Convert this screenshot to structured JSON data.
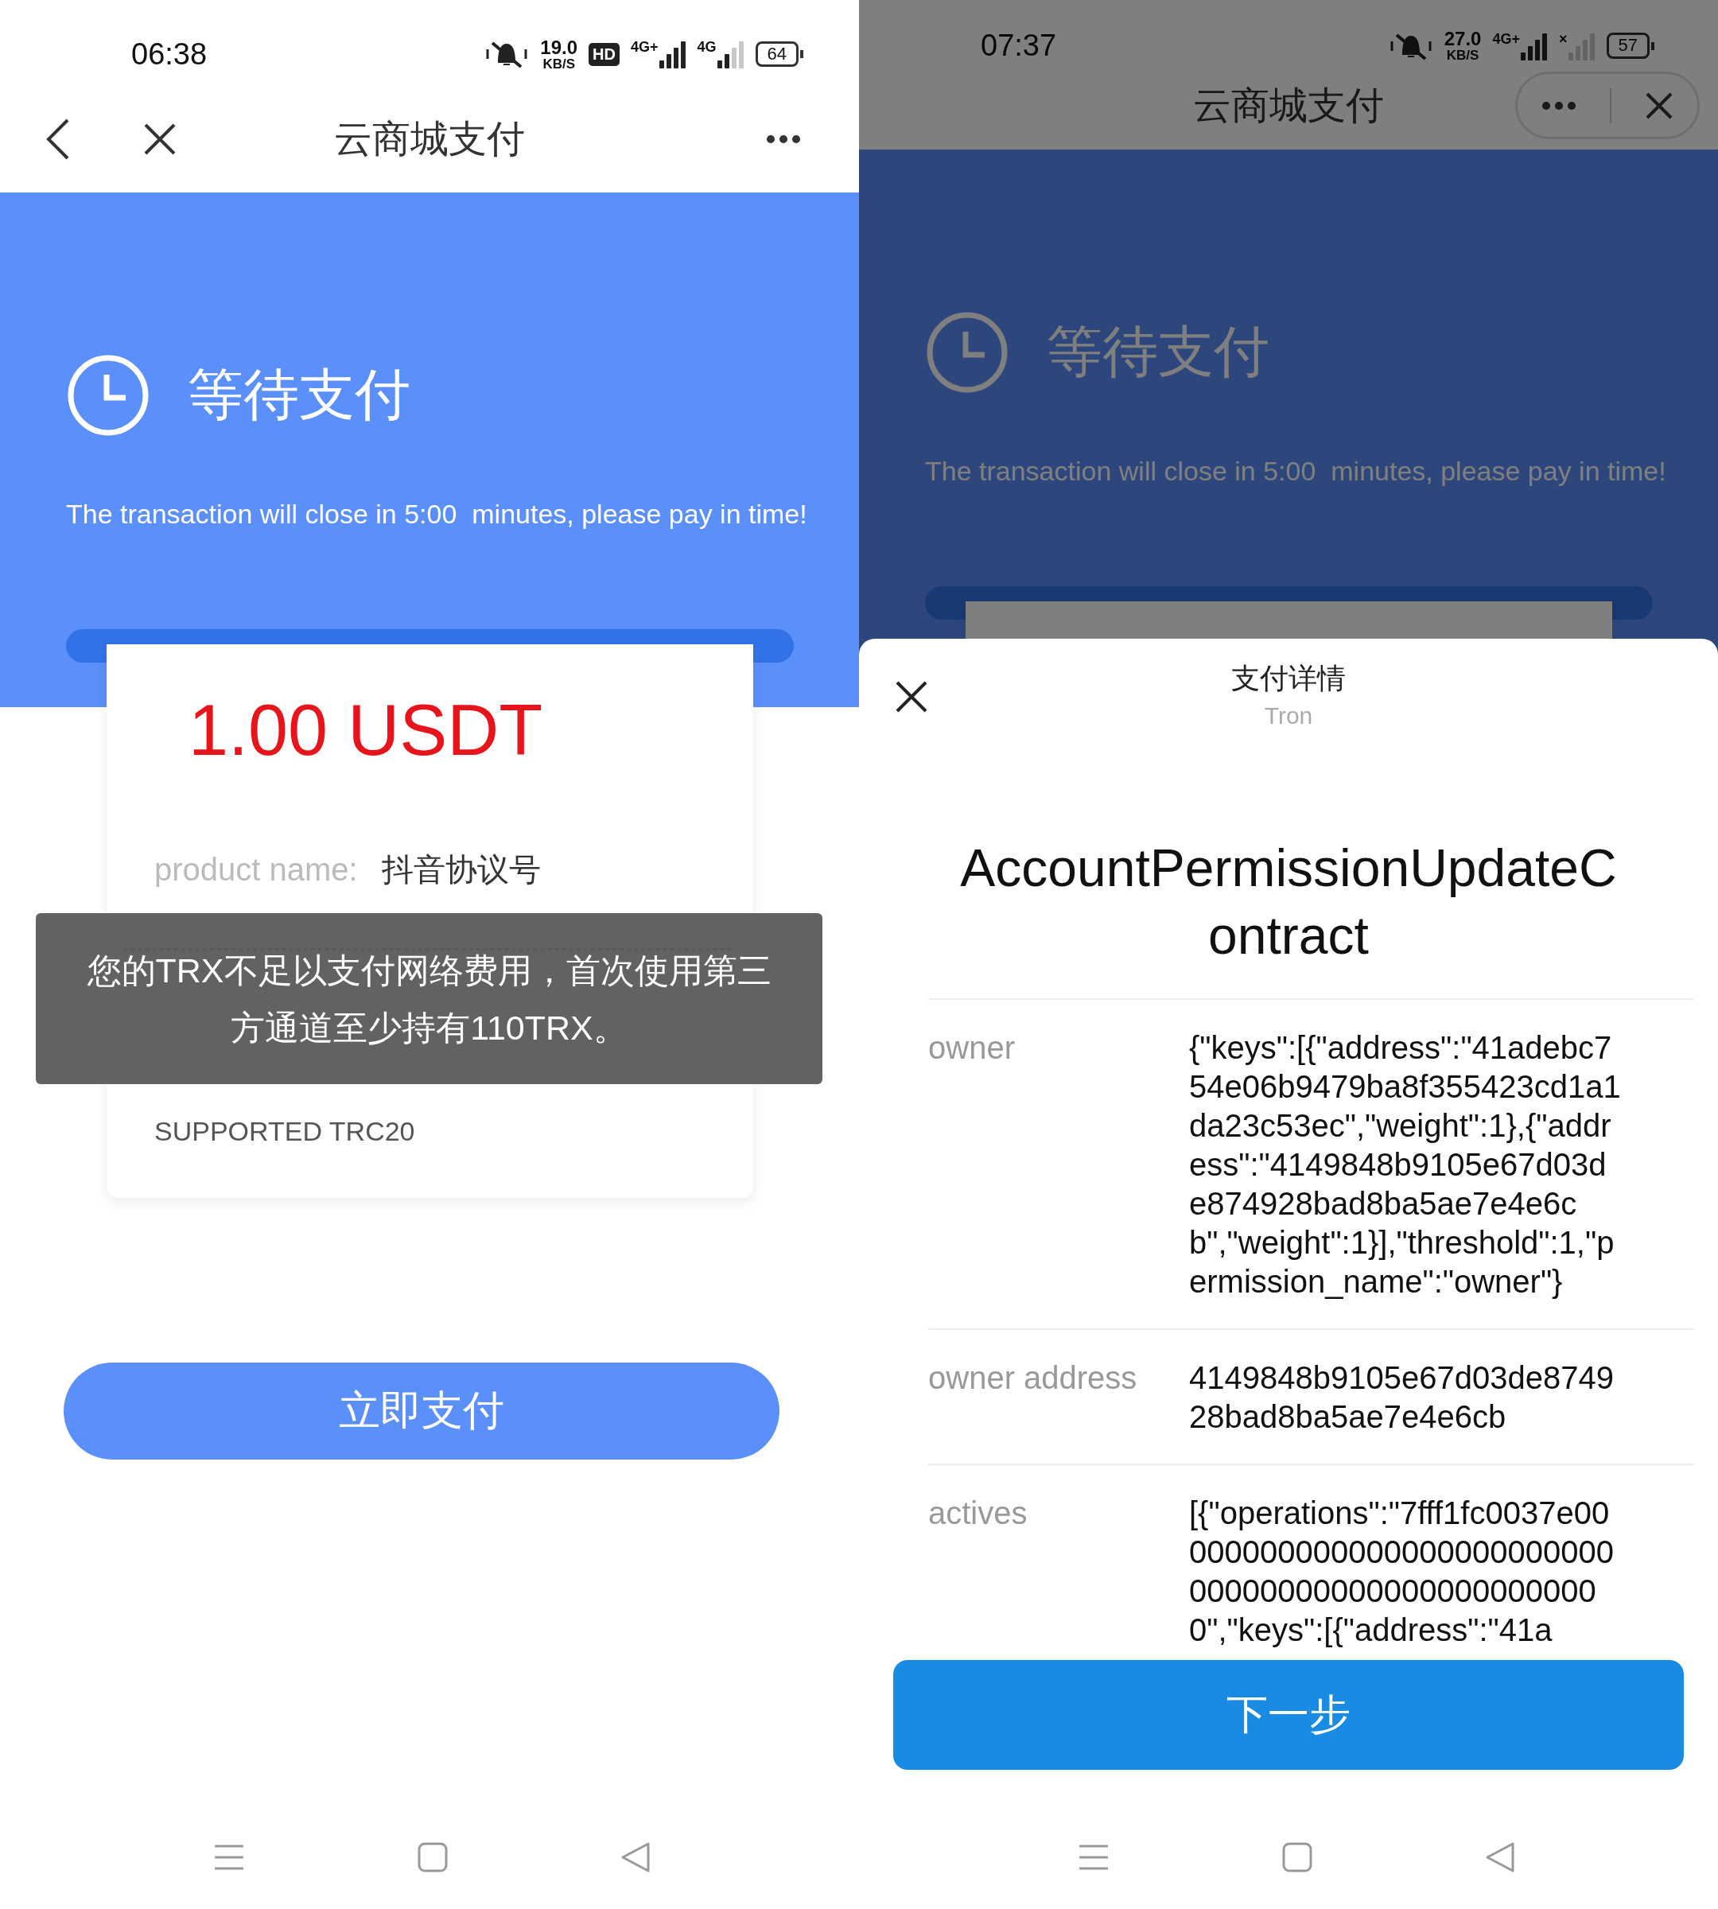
{
  "screens": [
    {
      "status_bar": {
        "time": "06:38",
        "items": [
          {
            "kind": "mute"
          },
          {
            "kind": "speed",
            "value": "19.0",
            "unit": "KB/S"
          },
          {
            "kind": "hd",
            "label": "HD"
          },
          {
            "kind": "signal",
            "label": "4G+"
          },
          {
            "kind": "signal_weak",
            "label": "4G"
          },
          {
            "kind": "battery",
            "label": "64"
          }
        ]
      },
      "nav": {
        "kind": "full",
        "title": "云商城支付"
      },
      "hero": {
        "status": "等待支付",
        "notice": "The transaction will close in 5:00  minutes, please pay in time!"
      },
      "card": {
        "amount": "1.00 USDT",
        "fields": [
          {
            "label": "product name:",
            "value": "抖音协议号"
          }
        ],
        "network": "SUPPORTED TRC20"
      },
      "toast": "您的TRX不足以支付网络费用，首次使用第三方通道至少持有110TRX。",
      "pay_button": "立即支付"
    },
    {
      "status_bar": {
        "time": "07:37",
        "items": [
          {
            "kind": "mute"
          },
          {
            "kind": "speed",
            "value": "27.0",
            "unit": "KB/S"
          },
          {
            "kind": "signal",
            "label": "4G+"
          },
          {
            "kind": "signal_off",
            "label": "×"
          },
          {
            "kind": "battery",
            "label": "57"
          }
        ]
      },
      "nav": {
        "kind": "capsule",
        "title": "云商城支付"
      },
      "hero": {
        "status": "等待支付",
        "notice": "The transaction will close in 5:00  minutes, please pay in time!"
      },
      "sheet": {
        "title": "支付详情",
        "subtitle": "Tron",
        "contract": "AccountPermissionUpdateContract",
        "rows": [
          {
            "label": "owner",
            "value": "{\"keys\":[{\"address\":\"41adebc754e06b9479ba8f355423cd1a1da23c53ec\",\"weight\":1},{\"address\":\"4149848b9105e67d03de874928bad8ba5ae7e4e6cb\",\"weight\":1}],\"threshold\":1,\"permission_name\":\"owner\"}"
          },
          {
            "label": "owner address",
            "value": "4149848b9105e67d03de874928bad8ba5ae7e4e6cb"
          },
          {
            "label": "actives",
            "value": "[{\"operations\":\"7fff1fc0037e00000000000000000000000000000000000000000000000000\",\"keys\":[{\"address\":\"41a"
          }
        ],
        "button": "下一步"
      }
    }
  ]
}
